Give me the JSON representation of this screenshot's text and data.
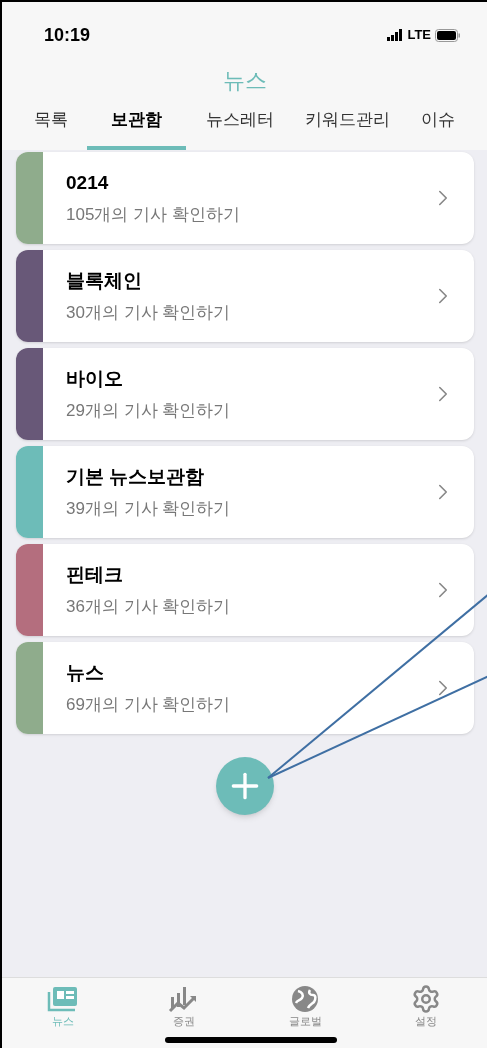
{
  "status_bar": {
    "time": "10:19",
    "network": "LTE"
  },
  "header": {
    "title": "뉴스"
  },
  "tabs": [
    {
      "label": "목록",
      "selected": false
    },
    {
      "label": "보관함",
      "selected": true
    },
    {
      "label": "뉴스레터",
      "selected": false
    },
    {
      "label": "키워드관리",
      "selected": false
    },
    {
      "label": "이슈",
      "selected": false
    }
  ],
  "folders": [
    {
      "title": "0214",
      "subtitle": "105개의 기사 확인하기",
      "color": "#8fac8c"
    },
    {
      "title": "블록체인",
      "subtitle": "30개의 기사 확인하기",
      "color": "#685878"
    },
    {
      "title": "바이오",
      "subtitle": "29개의 기사 확인하기",
      "color": "#685878"
    },
    {
      "title": "기본 뉴스보관함",
      "subtitle": "39개의 기사 확인하기",
      "color": "#6dbcb8"
    },
    {
      "title": "핀테크",
      "subtitle": "36개의 기사 확인하기",
      "color": "#b46e7e"
    },
    {
      "title": "뉴스",
      "subtitle": "69개의 기사 확인하기",
      "color": "#8fac8c"
    }
  ],
  "bottom_nav": [
    {
      "kind": "news",
      "label": "뉴스",
      "selected": true
    },
    {
      "kind": "stocks",
      "label": "증권",
      "selected": false
    },
    {
      "kind": "global",
      "label": "글로벌",
      "selected": false
    },
    {
      "kind": "settings",
      "label": "설정",
      "selected": false
    }
  ]
}
